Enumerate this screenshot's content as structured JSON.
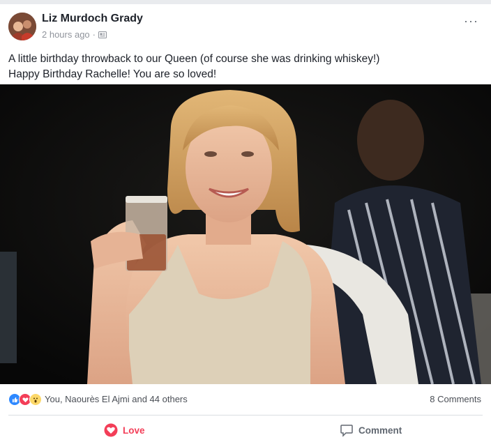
{
  "post": {
    "author": "Liz Murdoch Grady",
    "timestamp": "2 hours ago",
    "privacy_separator": "·",
    "more_label": "···",
    "text_line1": "A little birthday throwback to our Queen (of course she was drinking whiskey!)",
    "text_line2": "Happy Birthday Rachelle! You are so loved!"
  },
  "reactions": {
    "icons": [
      "like-icon",
      "love-icon",
      "wow-icon"
    ],
    "summary": "You, Naourès El Ajmi and 44 others",
    "comments": "8 Comments"
  },
  "actions": {
    "love_label": "Love",
    "comment_label": "Comment"
  },
  "colors": {
    "love": "#f33e58",
    "like": "#2d88ff",
    "wow": "#fcd869",
    "text": "#1d2129",
    "muted": "#90949c"
  }
}
